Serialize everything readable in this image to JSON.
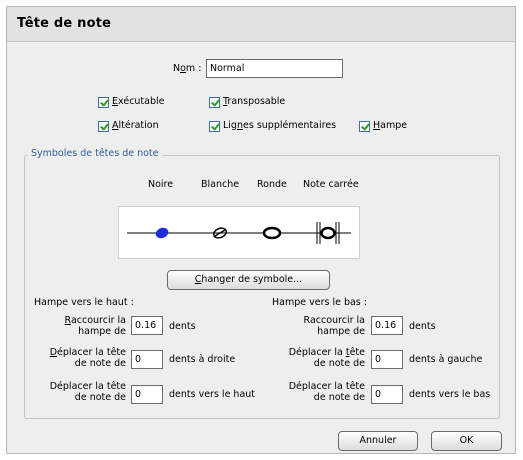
{
  "dialog": {
    "title": "Tête de note"
  },
  "name_field": {
    "label_pre": "N",
    "label_accel": "o",
    "label_post": "m :",
    "value": "Normal"
  },
  "options": {
    "executable": {
      "accel": "E",
      "rest": "xécutable"
    },
    "transposable": {
      "accel": "T",
      "rest": "ransposable"
    },
    "alteration": {
      "accel": "A",
      "rest": "ltération"
    },
    "ledger_lines": {
      "pre": "Lig",
      "accel": "n",
      "post": "es supplémentaires"
    },
    "stem": {
      "accel": "H",
      "rest": "ampe"
    }
  },
  "symbols_group": {
    "legend": "Symboles de têtes de note",
    "columns": [
      "Noire",
      "Blanche",
      "Ronde",
      "Note carrée"
    ],
    "change_button": {
      "accel": "C",
      "rest": "hanger de symbole..."
    }
  },
  "stem_up": {
    "heading": "Hampe vers le haut :",
    "shorten": {
      "line1_accel": "R",
      "line1_rest": "accourcir la",
      "line2": "hampe de",
      "value": "0.16",
      "unit": "dents"
    },
    "move_x": {
      "line1_accel": "D",
      "line1_rest": "éplacer la tête",
      "line2": "de note de",
      "value": "0",
      "unit": "dents à droite"
    },
    "move_y": {
      "line1": "Déplacer la tête",
      "line2": "de note de",
      "value": "0",
      "unit": "dents vers le haut"
    }
  },
  "stem_down": {
    "heading": "Hampe vers le bas :",
    "shorten": {
      "line1": "Raccourcir la",
      "line2": "hampe de",
      "value": "0.16",
      "unit": "dents"
    },
    "move_x": {
      "line1_pre": "Déplacer la ",
      "line1_accel": "t",
      "line1_rest": "ête",
      "line2": "de note de",
      "value": "0",
      "unit": "dents à gauche"
    },
    "move_y": {
      "line1": "Déplacer la tête",
      "line2": "de note de",
      "value": "0",
      "unit": "dents vers le bas"
    }
  },
  "buttons": {
    "cancel": "Annuler",
    "ok": "OK"
  },
  "colors": {
    "accent": "#2d5f9a",
    "filled_note": "#1f2fd6",
    "check": "#2a9a2a"
  }
}
